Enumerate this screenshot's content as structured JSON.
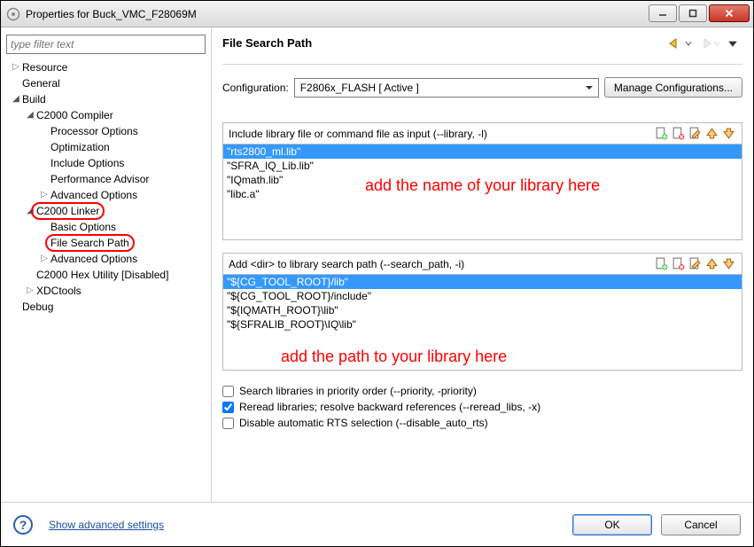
{
  "window": {
    "title": "Properties for Buck_VMC_F28069M"
  },
  "filter": {
    "placeholder": "type filter text"
  },
  "tree": [
    {
      "label": "Resource",
      "indent": 0,
      "twisty": "right"
    },
    {
      "label": "General",
      "indent": 0,
      "twisty": "none"
    },
    {
      "label": "Build",
      "indent": 0,
      "twisty": "down"
    },
    {
      "label": "C2000 Compiler",
      "indent": 1,
      "twisty": "down"
    },
    {
      "label": "Processor Options",
      "indent": 2,
      "twisty": "none"
    },
    {
      "label": "Optimization",
      "indent": 2,
      "twisty": "none"
    },
    {
      "label": "Include Options",
      "indent": 2,
      "twisty": "none"
    },
    {
      "label": "Performance Advisor",
      "indent": 2,
      "twisty": "none"
    },
    {
      "label": "Advanced Options",
      "indent": 2,
      "twisty": "right"
    },
    {
      "label": "C2000 Linker",
      "indent": 1,
      "twisty": "down",
      "ring": true
    },
    {
      "label": "Basic Options",
      "indent": 2,
      "twisty": "none"
    },
    {
      "label": "File Search Path",
      "indent": 2,
      "twisty": "none",
      "ring": true
    },
    {
      "label": "Advanced Options",
      "indent": 2,
      "twisty": "right"
    },
    {
      "label": "C2000 Hex Utility  [Disabled]",
      "indent": 1,
      "twisty": "none"
    },
    {
      "label": "XDCtools",
      "indent": 1,
      "twisty": "right"
    },
    {
      "label": "Debug",
      "indent": 0,
      "twisty": "none"
    }
  ],
  "page": {
    "title": "File Search Path",
    "config_label": "Configuration:",
    "config_value": "F2806x_FLASH  [ Active ]",
    "manage_label": "Manage Configurations..."
  },
  "panels": {
    "include": {
      "label": "Include library file or command file as input (--library, -l)",
      "items": [
        "\"rts2800_ml.lib\"",
        "\"SFRA_IQ_Lib.lib\"",
        "\"IQmath.lib\"",
        "\"libc.a\""
      ],
      "selected": 0,
      "annotation": "add the name of your library here"
    },
    "search": {
      "label": "Add <dir> to library search path (--search_path, -i)",
      "items": [
        "\"${CG_TOOL_ROOT}/lib\"",
        "\"${CG_TOOL_ROOT}/include\"",
        "\"${IQMATH_ROOT}\\lib\"",
        "\"${SFRALIB_ROOT}\\IQ\\lib\""
      ],
      "selected": 0,
      "annotation": "add the path to your library here"
    }
  },
  "checks": {
    "priority": {
      "label": "Search libraries in priority order (--priority, -priority)",
      "checked": false
    },
    "reread": {
      "label": "Reread libraries; resolve backward references (--reread_libs, -x)",
      "checked": true
    },
    "disable_rts": {
      "label": "Disable automatic RTS selection (--disable_auto_rts)",
      "checked": false
    }
  },
  "footer": {
    "advanced": "Show advanced settings",
    "ok": "OK",
    "cancel": "Cancel"
  }
}
